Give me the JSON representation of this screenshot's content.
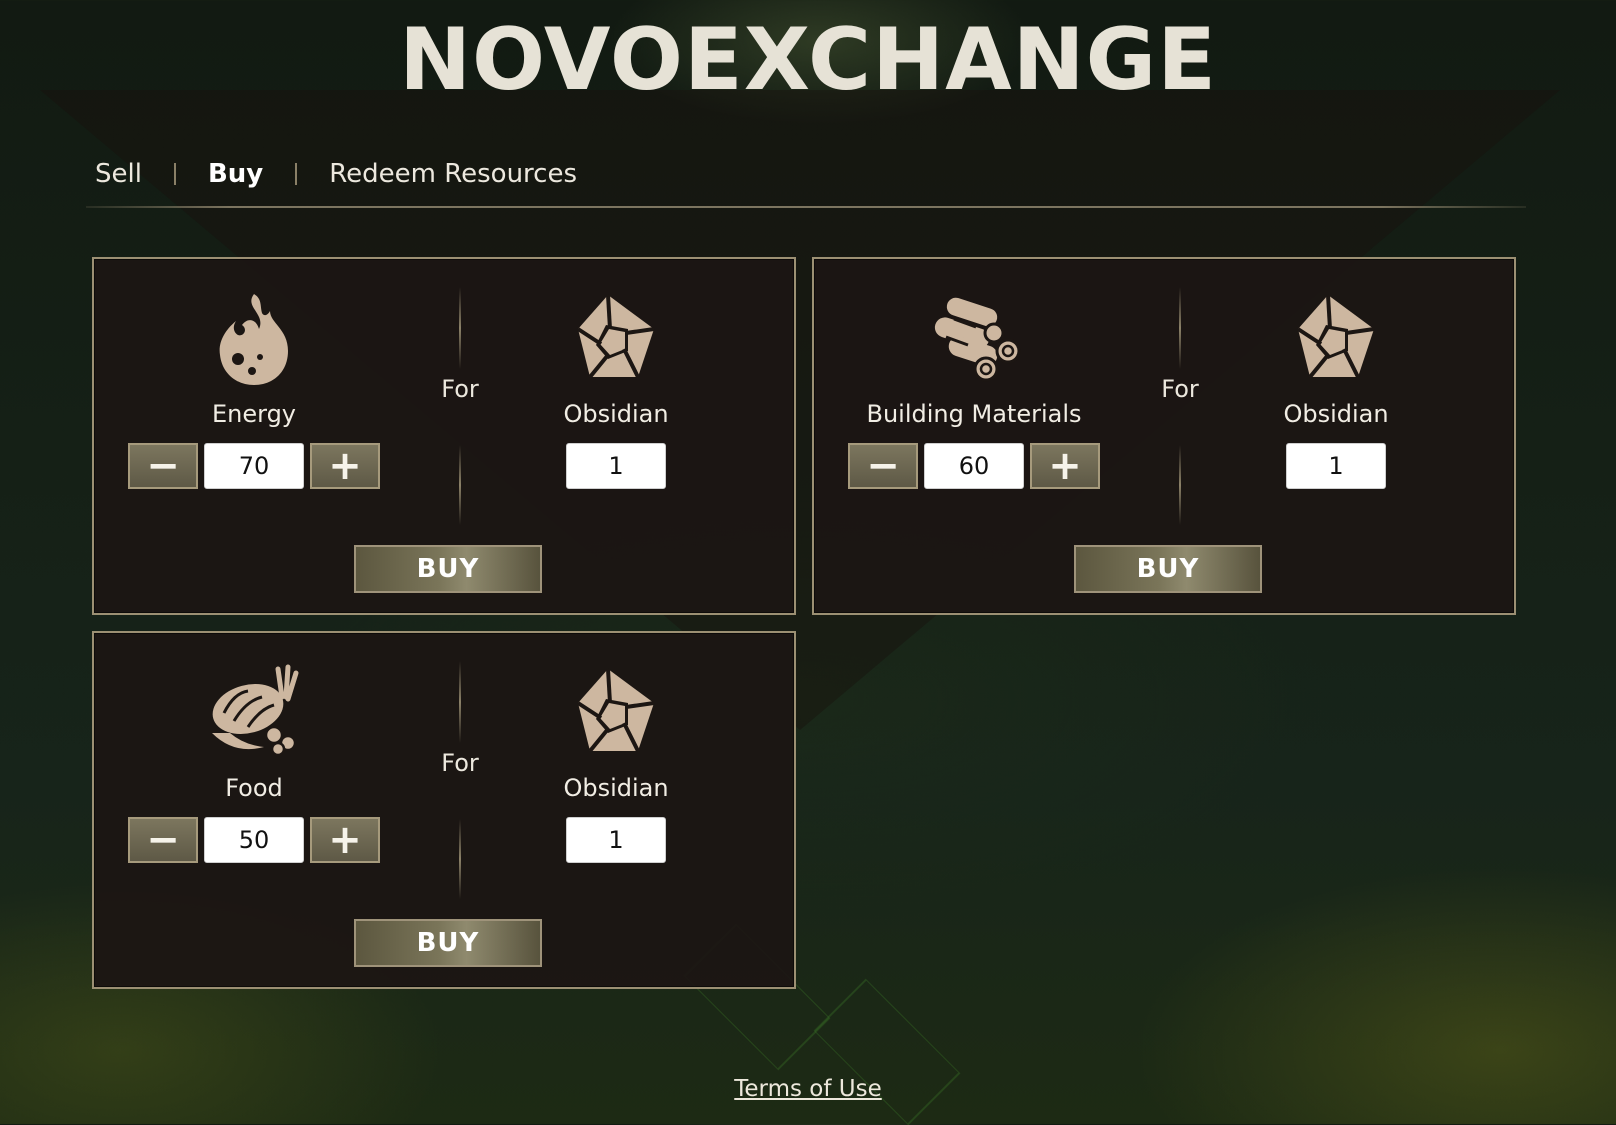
{
  "app": {
    "title": "NOVOEXCHANGE"
  },
  "tabs": [
    {
      "label": "Sell",
      "active": false
    },
    {
      "label": "Buy",
      "active": true
    },
    {
      "label": "Redeem Resources",
      "active": false
    }
  ],
  "cards": [
    {
      "resource": "Energy",
      "resource_icon": "flame-icon",
      "amount": "70",
      "for_label": "For",
      "currency": "Obsidian",
      "currency_icon": "obsidian-gem-icon",
      "price": "1",
      "decrement": "−",
      "increment": "+",
      "buy_label": "BUY"
    },
    {
      "resource": "Building Materials",
      "resource_icon": "logs-icon",
      "amount": "60",
      "for_label": "For",
      "currency": "Obsidian",
      "currency_icon": "obsidian-gem-icon",
      "price": "1",
      "decrement": "−",
      "increment": "+",
      "buy_label": "BUY"
    },
    {
      "resource": "Food",
      "resource_icon": "bread-icon",
      "amount": "50",
      "for_label": "For",
      "currency": "Obsidian",
      "currency_icon": "obsidian-gem-icon",
      "price": "1",
      "decrement": "−",
      "increment": "+",
      "buy_label": "BUY"
    }
  ],
  "footer": {
    "terms_label": "Terms of Use"
  },
  "colors": {
    "icon": "#cdb7a0",
    "panel_border": "#9c9073",
    "button": "#7a7559"
  }
}
